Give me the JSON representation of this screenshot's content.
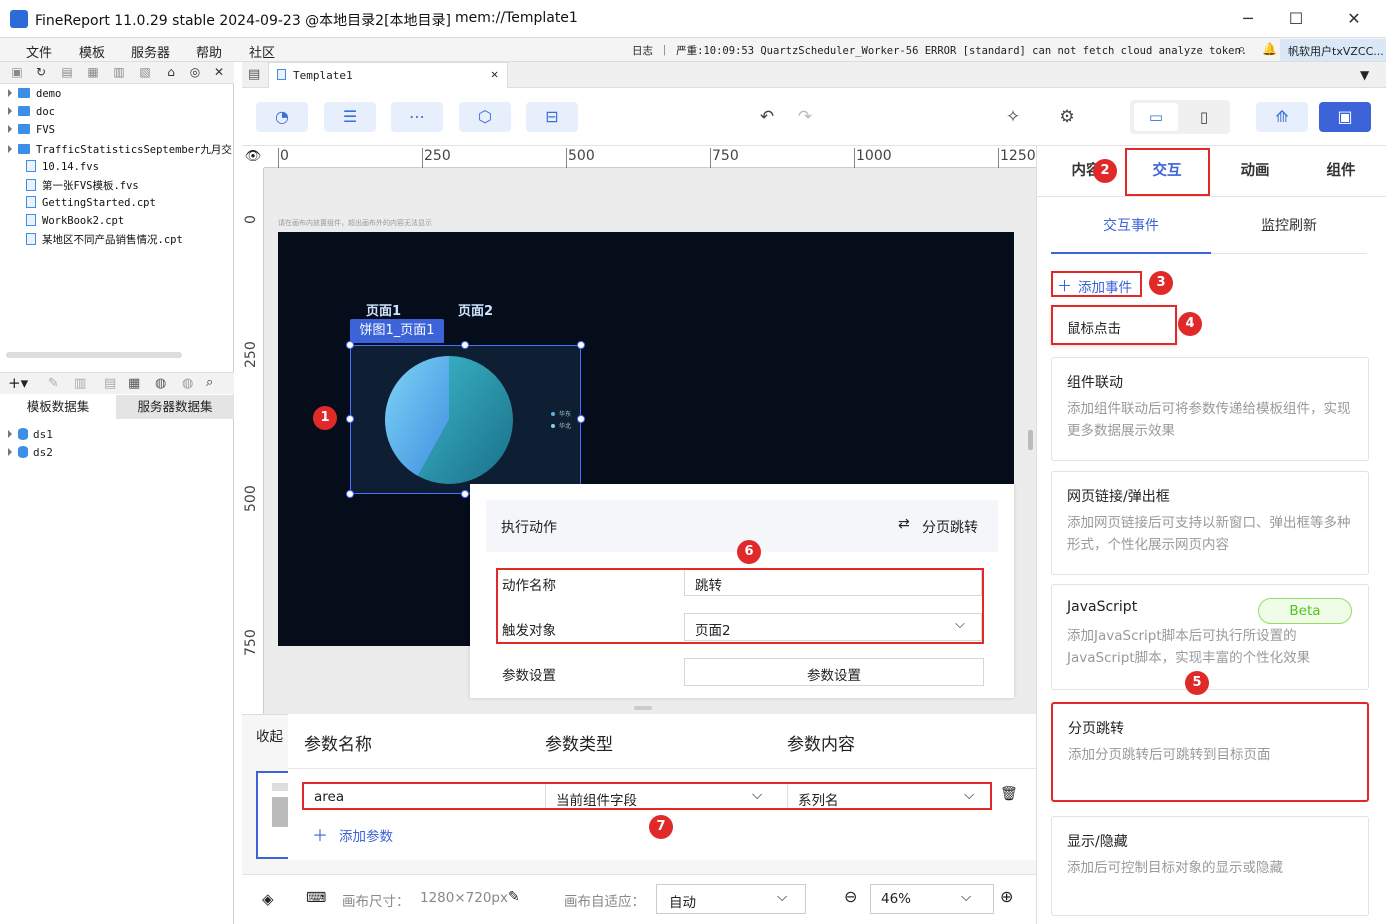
{
  "window": {
    "title": "FineReport 11.0.29 stable 2024-09-23 @本地目录2[本地目录]",
    "path": "mem://Template1"
  },
  "menu": [
    "文件",
    "模板",
    "服务器",
    "帮助",
    "社区"
  ],
  "log": {
    "text": "日志 ｜ 严重:10:09:53 QuartzScheduler_Worker-56 ERROR [standard] can not fetch cloud analyze token.",
    "user": "帆软用户txVZCC..."
  },
  "file_tree": [
    {
      "name": "demo",
      "type": "folder"
    },
    {
      "name": "doc",
      "type": "folder"
    },
    {
      "name": "FVS",
      "type": "folder"
    },
    {
      "name": "TrafficStatisticsSeptember九月交",
      "type": "folder"
    },
    {
      "name": "10.14.fvs",
      "type": "file"
    },
    {
      "name": "第一张FVS模板.fvs",
      "type": "file"
    },
    {
      "name": "GettingStarted.cpt",
      "type": "file"
    },
    {
      "name": "WorkBook2.cpt",
      "type": "file"
    },
    {
      "name": "某地区不同产品销售情况.cpt",
      "type": "file"
    }
  ],
  "dataset_tabs": [
    "模板数据集",
    "服务器数据集"
  ],
  "datasets": [
    "ds1",
    "ds2"
  ],
  "doc_tab": "Template1",
  "ruler": {
    "h": [
      "0",
      "250",
      "500",
      "750",
      "1000",
      "1250"
    ],
    "v": [
      "0",
      "250",
      "500",
      "750"
    ]
  },
  "canvas": {
    "hint": "请在画布内放置组件，超出画布外的内容无法显示",
    "page_tabs": [
      "页面1",
      "页面2"
    ],
    "widget_label": "饼图1_页面1",
    "legend": [
      "华东",
      "华北"
    ]
  },
  "popup": {
    "header_left": "执行动作",
    "header_right": "分页跳转",
    "rows": [
      {
        "label": "动作名称",
        "value": "跳转"
      },
      {
        "label": "触发对象",
        "value": "页面2"
      },
      {
        "label": "参数设置",
        "value": "参数设置"
      }
    ]
  },
  "params": {
    "collapse_label": "收起",
    "headers": [
      "参数名称",
      "参数类型",
      "参数内容"
    ],
    "row": {
      "name": "area",
      "type": "当前组件字段",
      "content": "系列名"
    },
    "add_label": "添加参数"
  },
  "status": {
    "canvas_size_label": "画布尺寸：",
    "canvas_size": "1280×720px",
    "fit_label": "画布自适应：",
    "fit_value": "自动",
    "zoom": "46%"
  },
  "right_panel": {
    "tabs": [
      "内容",
      "交互",
      "动画",
      "组件"
    ],
    "active_tab": "交互",
    "subtabs": [
      "交互事件",
      "监控刷新"
    ],
    "add_event": "添加事件",
    "event_type": "鼠标点击",
    "cards": [
      {
        "title": "组件联动",
        "desc": "添加组件联动后可将参数传递给模板组件，实现更多数据展示效果"
      },
      {
        "title": "网页链接/弹出框",
        "desc": "添加网页链接后可支持以新窗口、弹出框等多种形式，个性化展示网页内容"
      },
      {
        "title": "JavaScript",
        "desc": "添加JavaScript脚本后可执行所设置的JavaScript脚本，实现丰富的个性化效果",
        "badge": "Beta"
      },
      {
        "title": "分页跳转",
        "desc": "添加分页跳转后可跳转到目标页面"
      },
      {
        "title": "显示/隐藏",
        "desc": "添加后可控制目标对象的显示或隐藏"
      }
    ]
  },
  "annotations": [
    "1",
    "2",
    "3",
    "4",
    "5",
    "6",
    "7"
  ],
  "colors": {
    "accent": "#3c63d8",
    "annotation_red": "#e02a2a",
    "canvas_bg": "#050d1a",
    "beta_green": "#52c41a"
  }
}
